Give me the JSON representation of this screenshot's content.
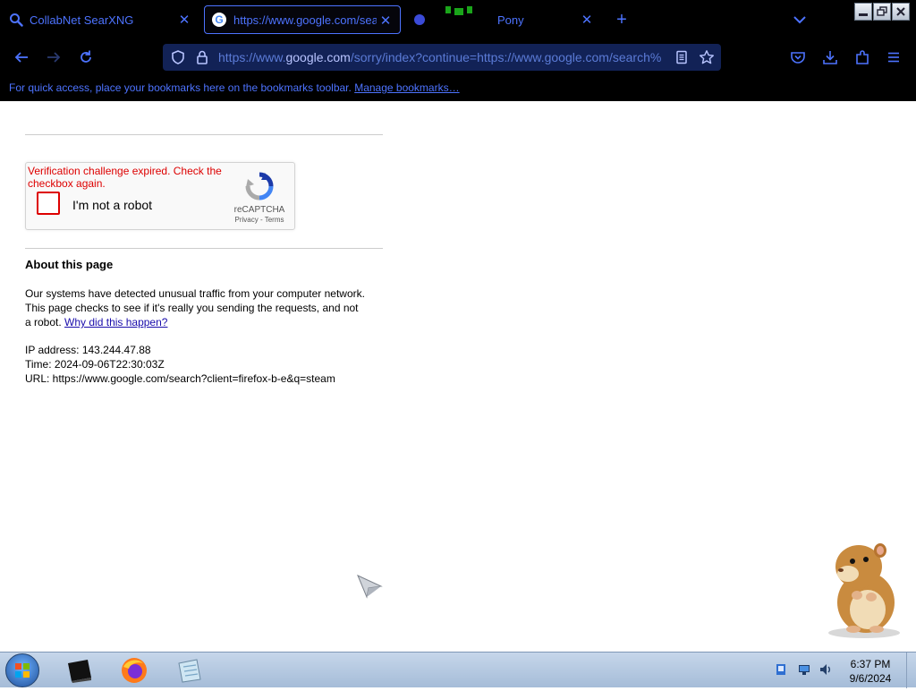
{
  "browser": {
    "tabs": [
      {
        "title": "CollabNet SearXNG",
        "close": "✕"
      },
      {
        "title": "https://www.google.com/sear",
        "close": "✕"
      },
      {
        "title": "Pony",
        "close": "✕"
      }
    ],
    "new_tab": "+",
    "address": {
      "prefix": "https://www.",
      "domain": "google.com",
      "path": "/sorry/index?continue=https://www.google.com/search%"
    },
    "bookmarks_bar": {
      "text": "For quick access, place your bookmarks here on the bookmarks toolbar.",
      "link": "Manage bookmarks…"
    },
    "accent_color": "#4d73ff"
  },
  "page": {
    "recaptcha": {
      "error": "Verification challenge expired. Check the checkbox again.",
      "label": "I'm not a robot",
      "brand": "reCAPTCHA",
      "links": "Privacy - Terms",
      "error_color": "#dd0000"
    },
    "about": {
      "heading": "About this page",
      "paragraph": "Our systems have detected unusual traffic from your computer network. This page checks to see if it's really you sending the requests, and not a robot.",
      "link": "Why did this happen?"
    },
    "info": {
      "ip": "IP address: 143.244.47.88",
      "time": "Time: 2024-09-06T22:30:03Z",
      "url": "URL: https://www.google.com/search?client=firefox-b-e&q=steam"
    }
  },
  "taskbar": {
    "time": "6:37 PM",
    "date": "9/6/2024"
  }
}
